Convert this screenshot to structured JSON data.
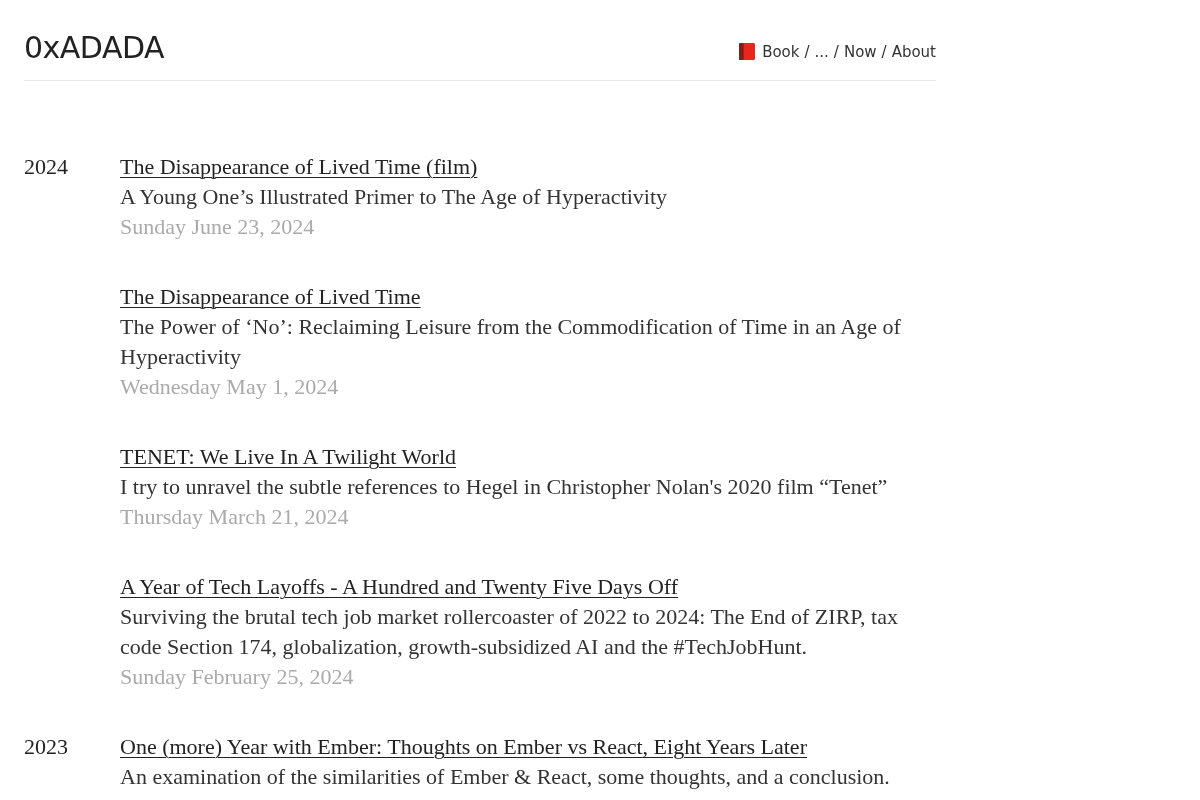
{
  "site": {
    "title": "0xADADA"
  },
  "nav": [
    {
      "label": "Book",
      "kind": "link"
    },
    {
      "label": "/",
      "kind": "separator"
    },
    {
      "label": "...",
      "kind": "link"
    },
    {
      "label": "/",
      "kind": "separator"
    },
    {
      "label": "Now",
      "kind": "link"
    },
    {
      "label": "/",
      "kind": "separator"
    },
    {
      "label": "About",
      "kind": "link"
    }
  ],
  "archive": [
    {
      "year": "2024",
      "posts": [
        {
          "title": "The Disappearance of Lived Time (film)",
          "subtitle": "A Young One’s Illustrated Primer to The Age of Hyperactivity",
          "date": "Sunday June 23, 2024"
        },
        {
          "title": "The Disappearance of Lived Time",
          "subtitle": "The Power of ‘No’: Reclaiming Leisure from the Commodification of Time in an Age of Hyperactivity",
          "date": "Wednesday May 1, 2024"
        },
        {
          "title": "TENET: We Live In A Twilight World",
          "subtitle": "I try to unravel the subtle references to Hegel in Christopher Nolan's 2020 film “Tenet”",
          "date": "Thursday March 21, 2024"
        },
        {
          "title": "A Year of Tech Layoffs - A Hundred and Twenty Five Days Off",
          "subtitle": "Surviving the brutal tech job market rollercoaster of 2022 to 2024: The End of ZIRP, tax code Section 174, globalization, growth-subsidized AI and the #TechJobHunt.",
          "date": "Sunday February 25, 2024"
        }
      ]
    },
    {
      "year": "2023",
      "posts": [
        {
          "title": "One (more) Year with Ember: Thoughts on Ember vs React, Eight Years Later",
          "subtitle": "An examination of the similarities of Ember & React, some thoughts, and a conclusion."
        }
      ]
    }
  ]
}
